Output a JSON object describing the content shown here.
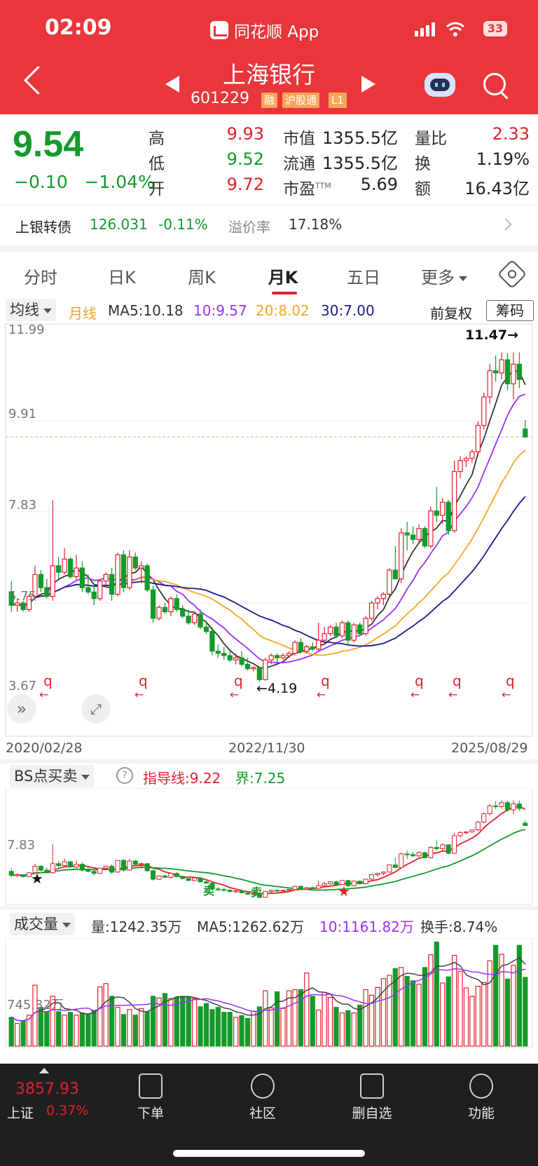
{
  "status": {
    "time": "02:09",
    "app": "同花顺 App",
    "battery": "33"
  },
  "header": {
    "name": "上海银行",
    "code": "601229",
    "tags": [
      "融",
      "沪股通",
      "L1"
    ]
  },
  "quote": {
    "price": "9.54",
    "change": "−0.10",
    "change_pct": "−1.04%",
    "high_label": "高",
    "high": "9.93",
    "low_label": "低",
    "low": "9.52",
    "open_label": "开",
    "open": "9.72",
    "mcap_label": "市值",
    "mcap": "1355.5亿",
    "float_label": "流通",
    "float": "1355.5亿",
    "pe_label": "市盈",
    "pe_sup": "TTM",
    "pe": "5.69",
    "vr_label": "量比",
    "vr": "2.33",
    "turnover_label": "换",
    "turnover": "1.19%",
    "amount_label": "额",
    "amount": "16.43亿"
  },
  "bond": {
    "label": "上银转债",
    "price": "126.031",
    "pct": "-0.11%",
    "premium_label": "溢价率",
    "premium": "17.18%"
  },
  "tabs": [
    "分时",
    "日K",
    "周K",
    "月K",
    "五日",
    "更多"
  ],
  "active_tab": "月K",
  "ma_bar": {
    "selector": "均线",
    "period": "月线",
    "ma5": "MA5:10.18",
    "ma10": "10:9.57",
    "ma20": "20:8.02",
    "ma30": "30:7.00",
    "adjust": "前复权",
    "chip": "筹码"
  },
  "kline": {
    "y_labels": [
      "11.99",
      "9.91",
      "7.83",
      "5.75",
      "3.67"
    ],
    "max_marker": "11.47→",
    "min_marker": "←4.19",
    "dates": [
      "2020/02/28",
      "2022/11/30",
      "2025/08/29"
    ],
    "event_marker": "q"
  },
  "bs": {
    "selector": "BS点买卖",
    "guide": "指导线:9.22",
    "bound": "界:7.25",
    "y_label": "7.83",
    "buy_text": "★",
    "sell_text": "卖"
  },
  "vol": {
    "selector": "成交量",
    "vol": "量:1242.35万",
    "ma5": "MA5:1262.62万",
    "ma10": "10:1161.82万",
    "turn": "换手:8.74%",
    "y_label": "745.32万"
  },
  "bottom": {
    "index_value": "3857.93",
    "index_name": "上证",
    "index_pct": "0.37%",
    "items": [
      "下单",
      "社区",
      "删自选",
      "功能"
    ]
  },
  "colors": {
    "header": "#e8363b",
    "up": "#e5202d",
    "down": "#149a2b",
    "ma5": "#333333",
    "ma10": "#9b30ff",
    "ma20": "#f5a623",
    "ma30": "#1a1a8c"
  },
  "chart_data": {
    "type": "candlestick",
    "title": "",
    "xlabel": "",
    "ylabel": "",
    "x_range": [
      "2020/02/28",
      "2025/08/29"
    ],
    "ylim": [
      3.67,
      11.99
    ],
    "ohlc": [
      [
        6.0,
        6.25,
        5.55,
        5.7
      ],
      [
        5.7,
        5.85,
        5.55,
        5.75
      ],
      [
        5.75,
        5.8,
        5.55,
        5.6
      ],
      [
        5.6,
        5.95,
        5.55,
        5.9
      ],
      [
        5.9,
        6.6,
        5.8,
        6.4
      ],
      [
        6.4,
        6.5,
        6.0,
        6.1
      ],
      [
        6.1,
        6.3,
        5.85,
        5.9
      ],
      [
        5.9,
        8.1,
        5.8,
        6.6
      ],
      [
        6.6,
        6.8,
        6.3,
        6.45
      ],
      [
        6.45,
        7.0,
        6.4,
        6.75
      ],
      [
        6.75,
        6.8,
        6.3,
        6.35
      ],
      [
        6.35,
        6.85,
        6.25,
        6.55
      ],
      [
        6.55,
        6.7,
        6.0,
        6.1
      ],
      [
        6.1,
        6.4,
        5.95,
        6.0
      ],
      [
        6.0,
        6.2,
        5.7,
        5.85
      ],
      [
        5.85,
        6.3,
        5.8,
        6.25
      ],
      [
        6.25,
        6.45,
        6.1,
        6.4
      ],
      [
        6.4,
        6.55,
        5.8,
        5.95
      ],
      [
        5.95,
        6.9,
        5.9,
        6.85
      ],
      [
        6.85,
        6.95,
        6.0,
        6.1
      ],
      [
        6.1,
        6.95,
        6.05,
        6.8
      ],
      [
        6.8,
        6.9,
        6.5,
        6.55
      ],
      [
        6.55,
        6.7,
        6.2,
        6.6
      ],
      [
        6.6,
        6.65,
        6.0,
        6.05
      ],
      [
        6.05,
        6.15,
        5.3,
        5.4
      ],
      [
        5.4,
        5.7,
        5.35,
        5.65
      ],
      [
        5.65,
        5.75,
        5.5,
        5.55
      ],
      [
        5.55,
        5.9,
        5.45,
        5.85
      ],
      [
        5.85,
        5.95,
        5.55,
        5.6
      ],
      [
        5.6,
        5.7,
        5.4,
        5.45
      ],
      [
        5.45,
        5.6,
        5.25,
        5.3
      ],
      [
        5.3,
        5.55,
        5.25,
        5.5
      ],
      [
        5.5,
        5.6,
        5.15,
        5.2
      ],
      [
        5.2,
        5.35,
        5.05,
        5.1
      ],
      [
        5.1,
        5.2,
        4.55,
        4.65
      ],
      [
        4.65,
        4.8,
        4.5,
        4.6
      ],
      [
        4.6,
        4.75,
        4.45,
        4.55
      ],
      [
        4.55,
        4.65,
        4.4,
        4.45
      ],
      [
        4.45,
        4.6,
        4.35,
        4.5
      ],
      [
        4.5,
        4.65,
        4.3,
        4.35
      ],
      [
        4.35,
        4.5,
        4.2,
        4.25
      ],
      [
        4.25,
        4.3,
        4.19,
        4.28
      ],
      [
        4.28,
        4.3,
        3.95,
        4.0
      ],
      [
        4.0,
        4.5,
        3.98,
        4.45
      ],
      [
        4.45,
        4.6,
        4.35,
        4.55
      ],
      [
        4.55,
        4.6,
        4.4,
        4.5
      ],
      [
        4.5,
        4.6,
        4.45,
        4.55
      ],
      [
        4.55,
        4.65,
        4.5,
        4.6
      ],
      [
        4.6,
        4.9,
        4.55,
        4.85
      ],
      [
        4.85,
        4.95,
        4.6,
        4.65
      ],
      [
        4.65,
        4.8,
        4.6,
        4.75
      ],
      [
        4.75,
        4.85,
        4.65,
        4.7
      ],
      [
        4.7,
        5.3,
        4.65,
        4.9
      ],
      [
        4.9,
        5.2,
        4.85,
        5.05
      ],
      [
        5.05,
        5.25,
        5.0,
        5.2
      ],
      [
        5.2,
        5.3,
        4.95,
        5.0
      ],
      [
        5.0,
        5.35,
        4.95,
        5.3
      ],
      [
        5.3,
        5.35,
        4.8,
        4.9
      ],
      [
        4.9,
        5.3,
        4.85,
        5.25
      ],
      [
        5.25,
        5.3,
        5.0,
        5.05
      ],
      [
        5.05,
        5.45,
        5.0,
        5.4
      ],
      [
        5.4,
        5.8,
        5.35,
        5.75
      ],
      [
        5.75,
        5.9,
        5.6,
        5.85
      ],
      [
        5.85,
        6.0,
        5.7,
        5.95
      ],
      [
        5.95,
        6.55,
        5.9,
        6.5
      ],
      [
        6.5,
        7.05,
        6.4,
        6.3
      ],
      [
        6.3,
        7.45,
        6.2,
        7.35
      ],
      [
        7.35,
        7.6,
        6.95,
        7.3
      ],
      [
        7.3,
        7.5,
        7.1,
        7.2
      ],
      [
        7.2,
        7.55,
        7.1,
        7.45
      ],
      [
        7.45,
        7.5,
        7.0,
        7.05
      ],
      [
        7.05,
        7.95,
        7.0,
        7.85
      ],
      [
        7.85,
        8.4,
        7.6,
        7.75
      ],
      [
        7.75,
        8.15,
        7.55,
        8.05
      ],
      [
        8.05,
        8.1,
        7.3,
        7.4
      ],
      [
        7.4,
        9.0,
        7.35,
        8.75
      ],
      [
        8.75,
        9.1,
        8.6,
        9.0
      ],
      [
        9.0,
        9.1,
        8.85,
        9.05
      ],
      [
        9.05,
        9.25,
        8.95,
        9.2
      ],
      [
        9.2,
        9.9,
        9.1,
        9.8
      ],
      [
        9.8,
        10.55,
        9.7,
        10.45
      ],
      [
        10.45,
        11.2,
        10.3,
        11.05
      ],
      [
        11.05,
        11.4,
        10.8,
        11.0
      ],
      [
        11.0,
        11.47,
        10.85,
        11.3
      ],
      [
        11.3,
        11.45,
        10.6,
        10.75
      ],
      [
        10.75,
        11.47,
        10.4,
        11.2
      ],
      [
        11.2,
        11.47,
        10.65,
        10.85
      ],
      [
        9.72,
        9.93,
        9.52,
        9.54
      ]
    ],
    "series": [
      {
        "name": "MA5",
        "values_from": "ohlc"
      },
      {
        "name": "10",
        "values_from": "ohlc"
      },
      {
        "name": "20",
        "values_from": "ohlc"
      },
      {
        "name": "30",
        "values_from": "ohlc"
      }
    ],
    "bs_guide_line": 9.22,
    "bs_bound_line": 7.25,
    "volume_ylim": [
      0,
      1900
    ],
    "volume_ref": 745.32,
    "volume": [
      520,
      410,
      450,
      560,
      1100,
      700,
      620,
      900,
      620,
      560,
      610,
      560,
      600,
      580,
      640,
      1070,
      1130,
      900,
      700,
      570,
      660,
      560,
      680,
      620,
      900,
      870,
      950,
      860,
      880,
      900,
      890,
      860,
      710,
      770,
      660,
      700,
      610,
      610,
      520,
      550,
      500,
      630,
      710,
      1000,
      690,
      980,
      680,
      1000,
      1020,
      1020,
      1320,
      900,
      650,
      970,
      880,
      700,
      600,
      640,
      600,
      740,
      1020,
      920,
      1060,
      1220,
      1280,
      1400,
      1420,
      1260,
      1180,
      1120,
      1420,
      1650,
      1880,
      1140,
      1250,
      1640,
      1350,
      1050,
      900,
      1080,
      1150,
      1540,
      1820,
      1660,
      1210,
      1460,
      1820,
      1242
    ]
  }
}
